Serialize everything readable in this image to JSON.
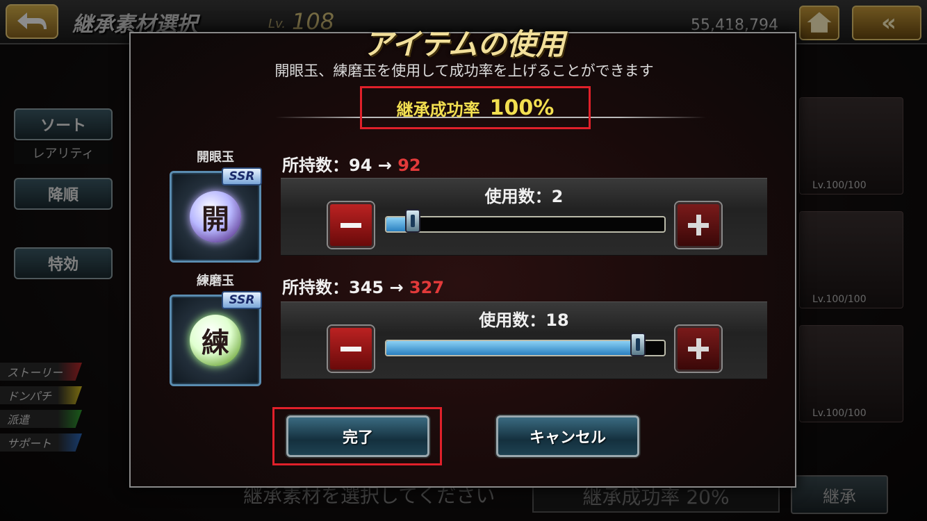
{
  "header": {
    "screen_title": "継承素材選択",
    "level_label": "Lv.",
    "level_value": "108",
    "money": "55,418,794",
    "menu_label": "«"
  },
  "sidebar": {
    "sort_button": "ソート",
    "sort_value": "レアリティ",
    "order_button": "降順",
    "effect_button": "特効",
    "tags": [
      {
        "label": "ストーリー",
        "color": "#c0282a"
      },
      {
        "label": "ドンパチ",
        "color": "#d8c020"
      },
      {
        "label": "派遣",
        "color": "#30a030"
      },
      {
        "label": "サポート",
        "color": "#2a6ac0"
      }
    ]
  },
  "background_cards": [
    {
      "level": "Lv.100/100"
    },
    {
      "level": "Lv.100/100"
    },
    {
      "level": "Lv.100/100"
    }
  ],
  "bottom": {
    "hint": "継承素材を選択してください",
    "rate": "継承成功率 20%",
    "inherit_button": "継承"
  },
  "dialog": {
    "title": "アイテムの使用",
    "description": "開眼玉、練磨玉を使用して成功率を上げることができます",
    "success_rate_label": "継承成功率",
    "success_rate_value": "100%",
    "items": [
      {
        "name": "開眼玉",
        "glyph": "開",
        "rarity": "SSR",
        "owned_label": "所持数：94 →",
        "owned_after": "92",
        "use_label": "使用数：2",
        "use_fraction": 0.1
      },
      {
        "name": "練磨玉",
        "glyph": "練",
        "rarity": "SSR",
        "owned_label": "所持数：345 →",
        "owned_after": "327",
        "use_label": "使用数：18",
        "use_fraction": 0.9
      }
    ],
    "done_button": "完了",
    "cancel_button": "キャンセル"
  }
}
